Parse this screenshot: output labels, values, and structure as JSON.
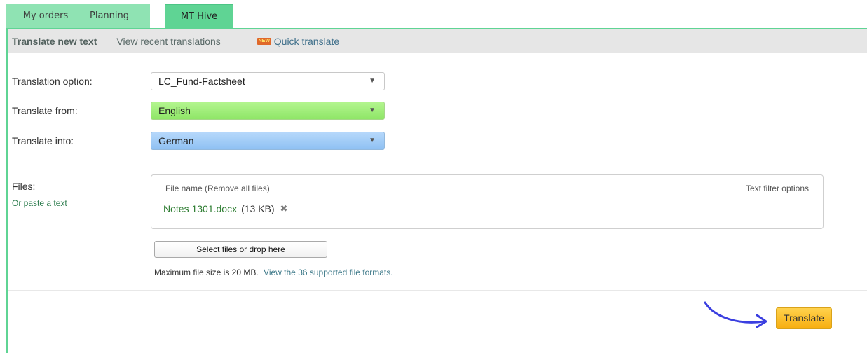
{
  "tabs": [
    {
      "label": "My orders",
      "active": false
    },
    {
      "label": "Planning",
      "active": false
    },
    {
      "label": "MT Hive",
      "active": true
    }
  ],
  "subnav": {
    "translate_new": "Translate new text",
    "recent": "View recent translations",
    "quick_badge": "NEW",
    "quick": "Quick translate"
  },
  "form": {
    "option_label": "Translation option:",
    "option_value": "LC_Fund-Factsheet",
    "from_label": "Translate from:",
    "from_value": "English",
    "into_label": "Translate into:",
    "into_value": "German"
  },
  "files": {
    "label": "Files:",
    "paste_link": "Or paste a text",
    "header_name": "File name",
    "remove_all": "(Remove all files)",
    "text_filter": "Text filter options",
    "items": [
      {
        "name": "Notes 1301.docx",
        "size": "(13 KB)"
      }
    ],
    "select_button": "Select files or drop here",
    "max_size": "Maximum file size is 20 MB.",
    "formats_link": "View the 36 supported file formats."
  },
  "actions": {
    "translate": "Translate"
  },
  "colors": {
    "tab_green": "#8fe3b3",
    "tab_active": "#5fd494",
    "from_green": "#8fe667",
    "into_blue": "#8fc1f3",
    "button_orange": "#f7ae10",
    "arrow_blue": "#3b3fe0"
  }
}
